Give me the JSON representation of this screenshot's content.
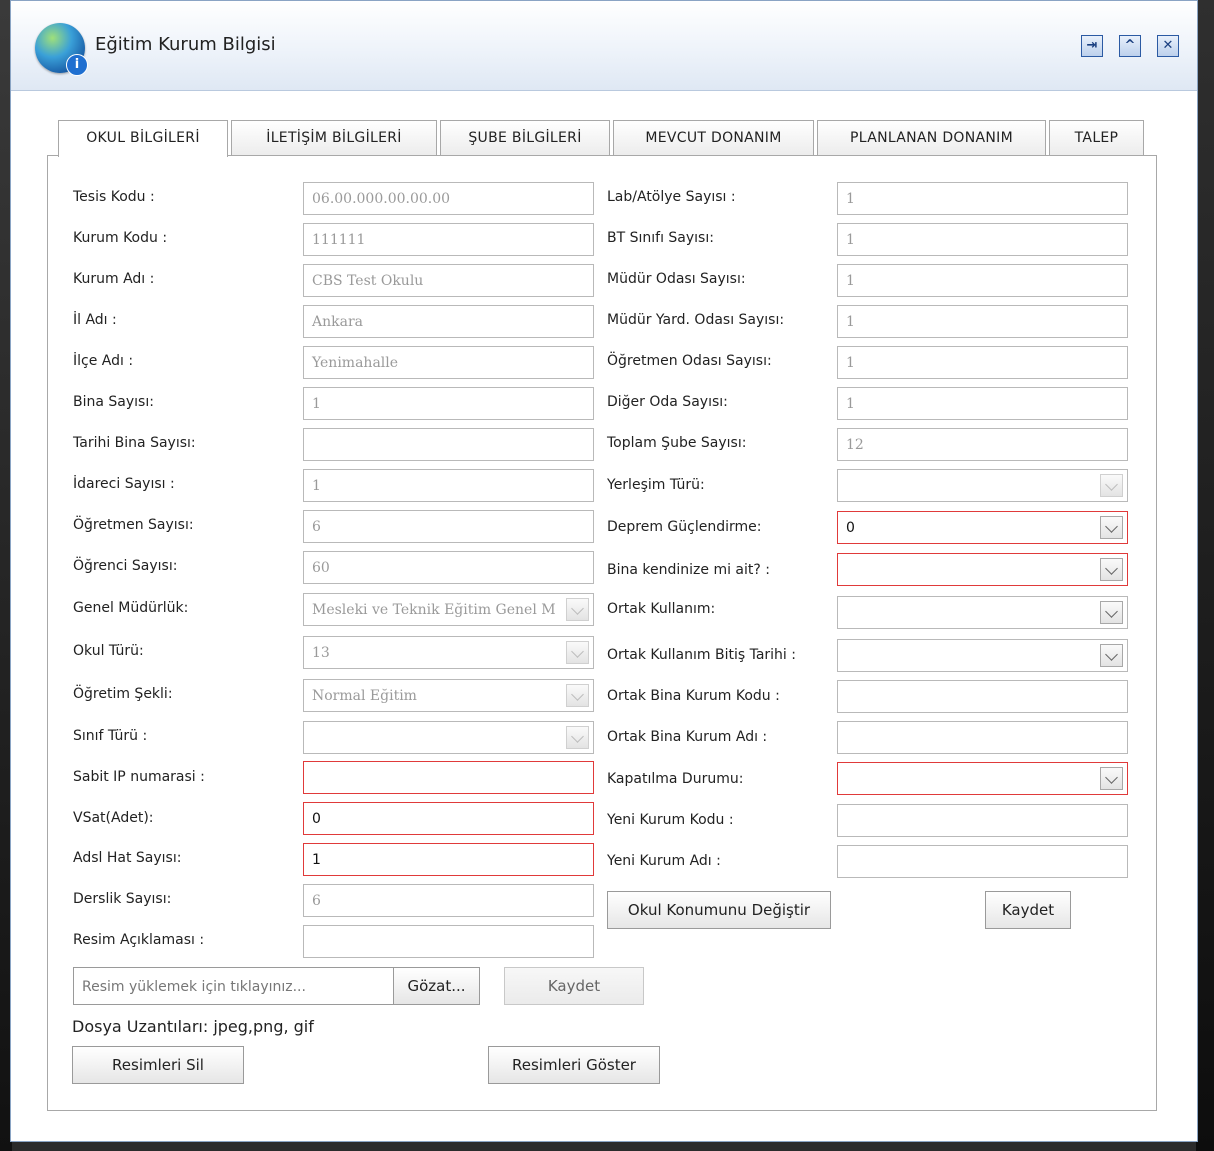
{
  "window": {
    "title": "Eğitim Kurum Bilgisi",
    "icons": {
      "app": "globe-info-icon",
      "pin": "pin-icon",
      "collapse": "collapse-icon",
      "close": "close-icon"
    }
  },
  "tabs": [
    {
      "label": "OKUL BİLGİLERİ",
      "active": true
    },
    {
      "label": "İLETİŞİM BİLGİLERİ"
    },
    {
      "label": "ŞUBE BİLGİLERİ"
    },
    {
      "label": "MEVCUT DONANIM"
    },
    {
      "label": "PLANLANAN DONANIM"
    },
    {
      "label": "TALEP"
    }
  ],
  "left": {
    "tesis_kodu": {
      "label": "Tesis Kodu :",
      "value": "06.00.000.00.00.00"
    },
    "kurum_kodu": {
      "label": "Kurum Kodu :",
      "value": "111111"
    },
    "kurum_adi": {
      "label": "Kurum Adı :",
      "value": "CBS Test Okulu"
    },
    "il_adi": {
      "label": "İl Adı :",
      "value": "Ankara"
    },
    "ilce_adi": {
      "label": "İlçe Adı :",
      "value": "Yenimahalle"
    },
    "bina_sayisi": {
      "label": "Bina Sayısı:",
      "value": "1"
    },
    "tarihi_bina": {
      "label": "Tarihi Bina Sayısı:",
      "value": ""
    },
    "idareci": {
      "label": "İdareci Sayısı :",
      "value": "1"
    },
    "ogretmen": {
      "label": "Öğretmen Sayısı:",
      "value": "6"
    },
    "ogrenci": {
      "label": "Öğrenci Sayısı:",
      "value": "60"
    },
    "genel_mudurluk": {
      "label": "Genel Müdürlük:",
      "value": "Mesleki ve Teknik Eğitim Genel M"
    },
    "okul_turu": {
      "label": "Okul Türü:",
      "value": "13"
    },
    "ogretim_sekli": {
      "label": "Öğretim Şekli:",
      "value": "Normal Eğitim"
    },
    "sinif_turu": {
      "label": "Sınıf Türü :",
      "value": ""
    },
    "sabit_ip": {
      "label": "Sabit IP numarasi :",
      "value": ""
    },
    "vsat": {
      "label": "VSat(Adet):",
      "value": "0"
    },
    "adsl": {
      "label": "Adsl Hat Sayısı:",
      "value": "1"
    },
    "derslik": {
      "label": "Derslik Sayısı:",
      "value": "6"
    },
    "resim_aciklama": {
      "label": "Resim Açıklaması :",
      "value": ""
    }
  },
  "right": {
    "lab": {
      "label": "Lab/Atölye Sayısı :",
      "value": "1"
    },
    "bt_sinifi": {
      "label": "BT Sınıfı Sayısı:",
      "value": "1"
    },
    "mudur_odasi": {
      "label": "Müdür Odası Sayısı:",
      "value": "1"
    },
    "mudur_yard": {
      "label": "Müdür Yard. Odası Sayısı:",
      "value": "1"
    },
    "ogretmen_odasi": {
      "label": "Öğretmen Odası Sayısı:",
      "value": "1"
    },
    "diger_oda": {
      "label": "Diğer Oda Sayısı:",
      "value": "1"
    },
    "toplam_sube": {
      "label": "Toplam Şube Sayısı:",
      "value": "12"
    },
    "yerlesim": {
      "label": "Yerleşim Türü:",
      "value": ""
    },
    "deprem": {
      "label": "Deprem Güçlendirme:",
      "value": "0"
    },
    "bina_ait": {
      "label": "Bina kendinize mi ait? :",
      "value": ""
    },
    "ortak_kullanim": {
      "label": "Ortak Kullanım:",
      "value": ""
    },
    "ortak_bitis": {
      "label": "Ortak Kullanım Bitiş Tarihi :",
      "value": ""
    },
    "ortak_bina_kodu": {
      "label": "Ortak Bina Kurum Kodu :",
      "value": ""
    },
    "ortak_bina_adi": {
      "label": "Ortak Bina Kurum Adı :",
      "value": ""
    },
    "kapatilma": {
      "label": "Kapatılma Durumu:",
      "value": ""
    },
    "yeni_kurum_kodu": {
      "label": "Yeni Kurum Kodu :",
      "value": ""
    },
    "yeni_kurum_adi": {
      "label": "Yeni Kurum Adı :",
      "value": ""
    }
  },
  "buttons": {
    "okul_konum": "Okul Konumunu Değiştir",
    "kaydet": "Kaydet",
    "gozat": "Gözat...",
    "kaydet_resim": "Kaydet",
    "resimleri_sil": "Resimleri Sil",
    "resimleri_goster": "Resimleri Göster"
  },
  "upload": {
    "placeholder": "Resim yüklemek için tıklayınız..."
  },
  "dosya_uzantilari": "Dosya Uzantıları: jpeg,png, gif"
}
